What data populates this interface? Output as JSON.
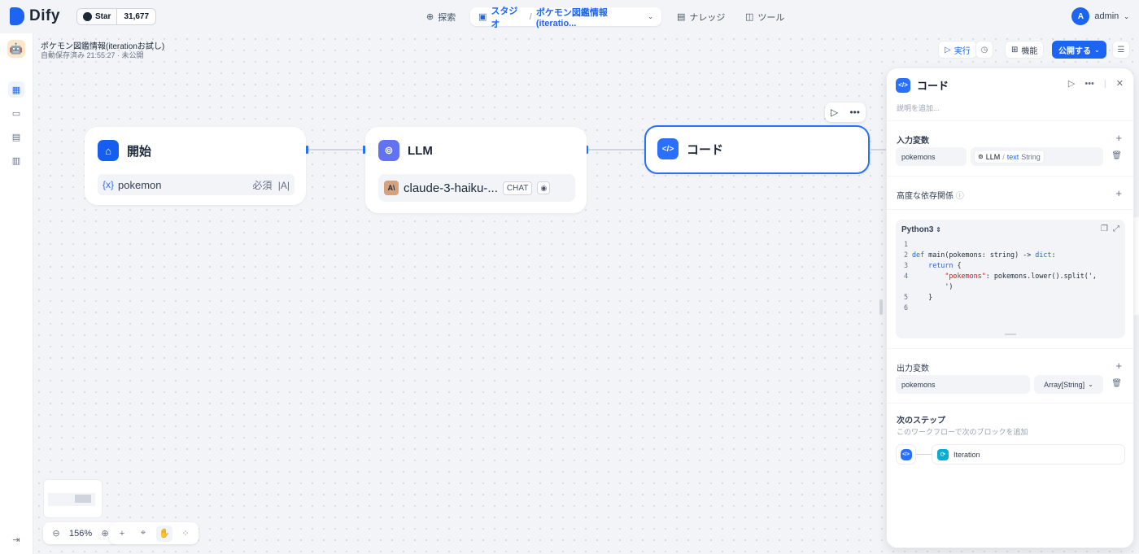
{
  "nav": {
    "logo": "Dify",
    "github_star": "Star",
    "github_count": "31,677",
    "explore": "探索",
    "studio": "スタジオ",
    "studio_app": "ポケモン図鑑情報(iteratio...",
    "knowledge": "ナレッジ",
    "tools": "ツール",
    "user_initial": "A",
    "user_name": "admin"
  },
  "app": {
    "title": "ポケモン図鑑情報(iterationお試し)",
    "status": "自動保存済み 21:55:27 · 未公開"
  },
  "toolbar": {
    "run": "実行",
    "features": "機能",
    "publish": "公開する"
  },
  "nodes": {
    "start": {
      "title": "開始",
      "var_icon": "{x}",
      "var_name": "pokemon",
      "var_required": "必須",
      "var_type": "|A|"
    },
    "llm": {
      "title": "LLM",
      "model": "claude-3-haiku-...",
      "mode": "CHAT"
    },
    "code": {
      "title": "コード"
    }
  },
  "zoom": {
    "level": "156%"
  },
  "panel": {
    "title": "コード",
    "description_placeholder": "説明を追加...",
    "input_section": "入力変数",
    "input_var_name": "pokemons",
    "input_ref_node": "LLM",
    "input_ref_var": "text",
    "input_ref_type": "String",
    "advanced_deps": "高度な依存関係",
    "language": "Python3",
    "code_lines": [
      {
        "no": "1",
        "text": ""
      },
      {
        "no": "2",
        "text": "def main(pokemons: string) -> dict:"
      },
      {
        "no": "3",
        "text": "    return {"
      },
      {
        "no": "4",
        "text": "        \"pokemons\": pokemons.lower().split(',\n        ')"
      },
      {
        "no": "5",
        "text": "    }"
      },
      {
        "no": "6",
        "text": ""
      }
    ],
    "output_section": "出力変数",
    "output_var_name": "pokemons",
    "output_var_type": "Array[String]",
    "next_step_title": "次のステップ",
    "next_step_desc": "このワークフローで次のブロックを追加",
    "next_block": "Iteration"
  },
  "colors": {
    "accent": "#1c64f2",
    "start_icon": "#155eef",
    "llm_icon": "#6172f3",
    "code_icon": "#2970ff",
    "iteration_icon": "#06aed4"
  }
}
